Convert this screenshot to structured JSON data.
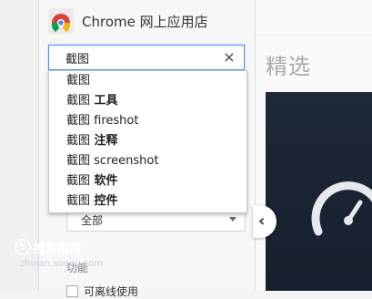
{
  "store": {
    "title": "Chrome 网上应用店"
  },
  "search": {
    "value": "截图",
    "clear_label": "×"
  },
  "suggestions": [
    {
      "prefix": "截图",
      "rest": ""
    },
    {
      "prefix": "截图",
      "rest": " 工具"
    },
    {
      "prefix": "截图",
      "rest": " fireshot"
    },
    {
      "prefix": "截图",
      "rest": " 注释"
    },
    {
      "prefix": "截图",
      "rest": " screenshot"
    },
    {
      "prefix": "截图",
      "rest": " 软件"
    },
    {
      "prefix": "截图",
      "rest": " 控件"
    }
  ],
  "filters": {
    "category_select": "全部",
    "features_label": "功能",
    "offline_checkbox_label": "可离线使用"
  },
  "main": {
    "featured_title": "精选",
    "carousel_prev": "‹"
  },
  "watermark": {
    "mark": "S",
    "text": "搜狗指南",
    "url": "zhinan.sogou.com"
  },
  "colors": {
    "focus_border": "#4d90fe",
    "banner_bg": "#1e2a39"
  }
}
